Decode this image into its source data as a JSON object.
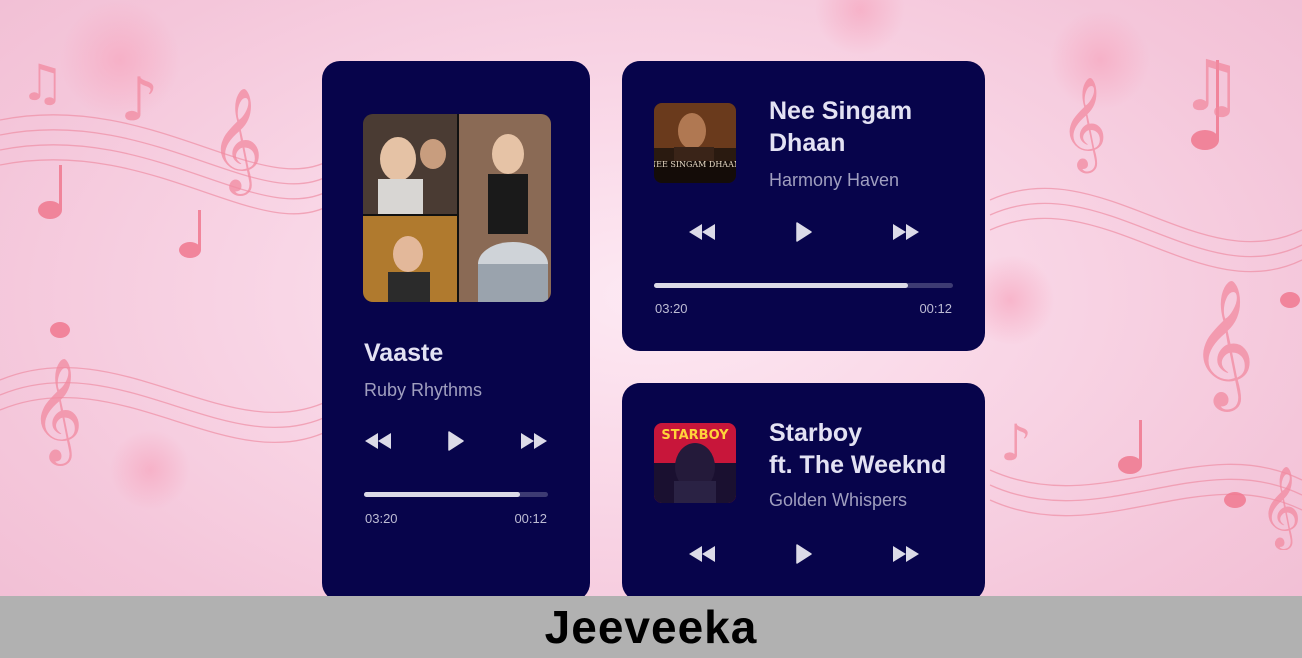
{
  "brand": {
    "name": "Jeeveeka"
  },
  "icons": {
    "rewind": "rewind-icon",
    "play": "play-icon",
    "forward": "fast-forward-icon"
  },
  "colors": {
    "card": "#07044b",
    "accent": "#dcdbe8",
    "background": "#f9d6e6",
    "footer": "#b1b1b1"
  },
  "players": [
    {
      "title": "Vaaste",
      "artist": "Ruby Rhythms",
      "elapsed": "03:20",
      "remaining": "00:12",
      "progress": 0.85
    },
    {
      "title": "Nee Singam\nDhaan",
      "artist": "Harmony Haven",
      "elapsed": "03:20",
      "remaining": "00:12",
      "progress": 0.85,
      "cover_text": "NEE SINGAM DHAAN"
    },
    {
      "title": "Starboy\nft. The Weeknd",
      "artist": "Golden Whispers",
      "cover_text": "STARBOY"
    }
  ]
}
